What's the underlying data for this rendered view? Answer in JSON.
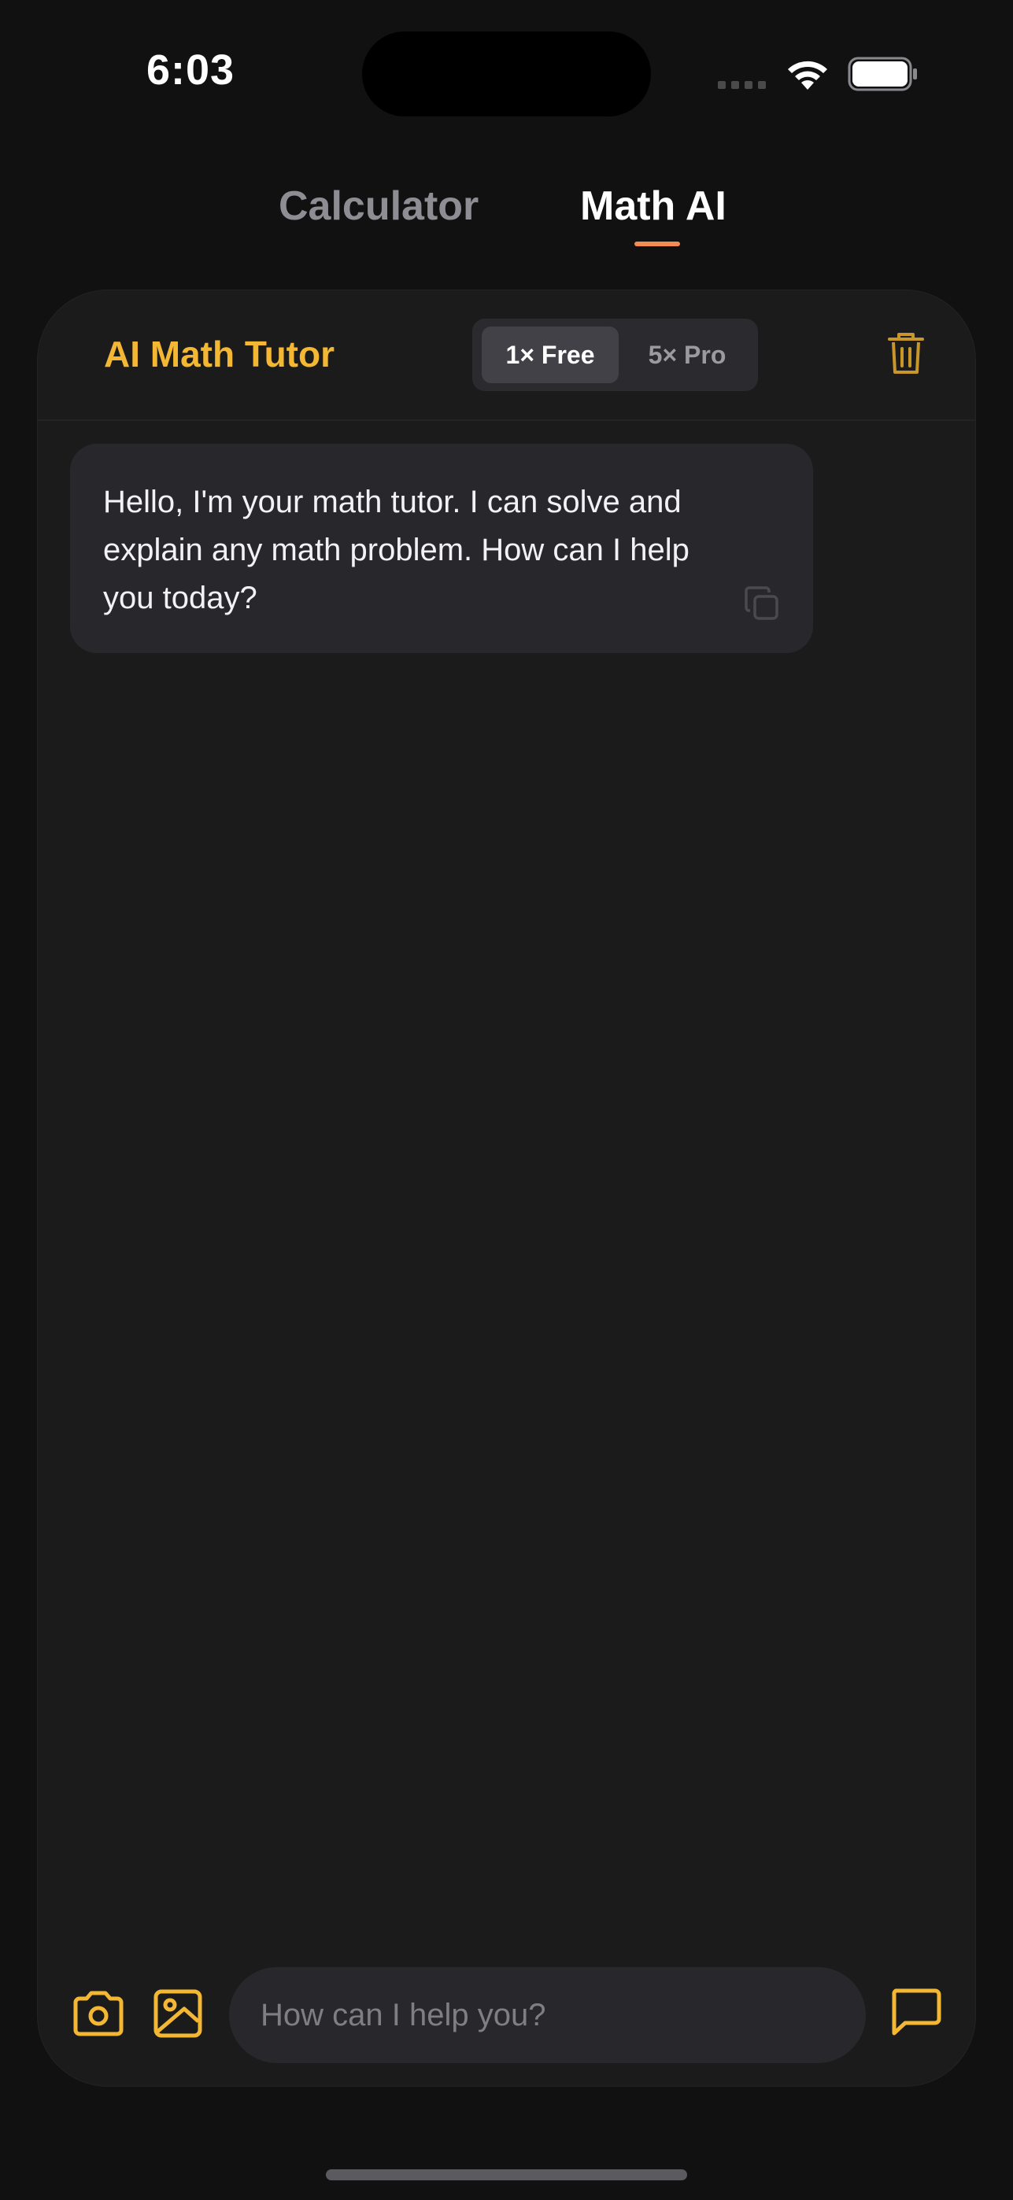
{
  "status_bar": {
    "time": "6:03"
  },
  "tabs": [
    {
      "label": "Calculator"
    },
    {
      "label": "Math AI"
    }
  ],
  "header": {
    "title": "AI Math Tutor",
    "modes": [
      {
        "label": "1× Free"
      },
      {
        "label": "5× Pro"
      }
    ]
  },
  "messages": [
    {
      "text": "Hello, I'm your math tutor. I can solve and explain any math problem. How can I help you today?"
    }
  ],
  "composer": {
    "placeholder": "How can I help you?"
  },
  "colors": {
    "accent": "#f3b733",
    "tab_underline": "#f28c50",
    "background": "#111112",
    "card": "#1b1b1c"
  },
  "icons": [
    "wifi-icon",
    "battery-icon",
    "trash-icon",
    "copy-icon",
    "camera-icon",
    "image-icon",
    "chat-send-icon"
  ]
}
